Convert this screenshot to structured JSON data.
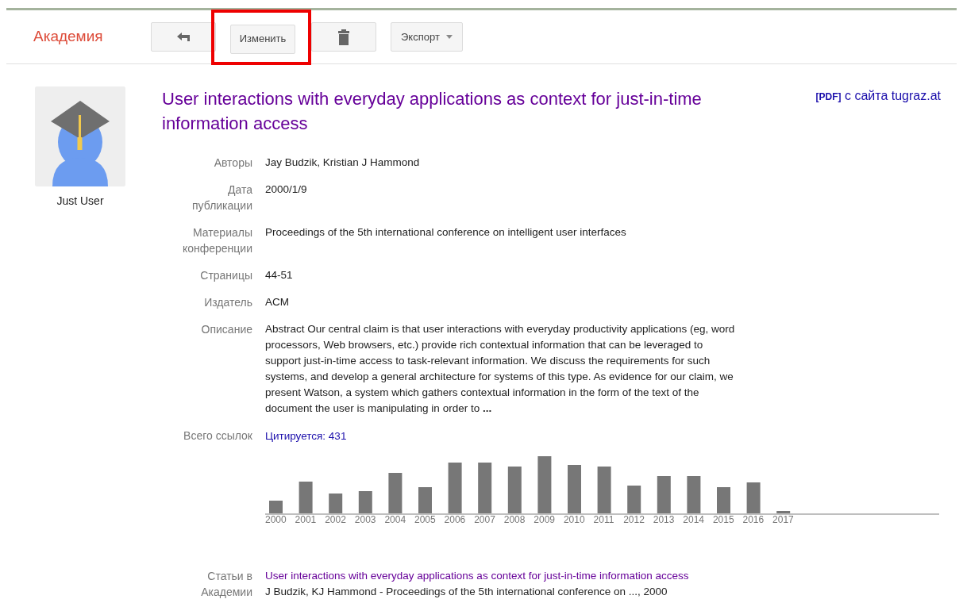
{
  "header": {
    "logo": "Академия",
    "buttons": [
      {
        "kind": "back",
        "highlighted": false
      },
      {
        "kind": "text",
        "label": "Изменить",
        "highlighted": true
      },
      {
        "kind": "delete",
        "highlighted": false
      },
      {
        "kind": "dropdown",
        "label": "Экспорт",
        "highlighted": false
      }
    ]
  },
  "profile": {
    "name": "Just User"
  },
  "article": {
    "title": "User interactions with everyday applications as context for just-in-time information access",
    "source_tag": "[PDF]",
    "source": "с сайта tugraz.at"
  },
  "fields": [
    {
      "kind": "text",
      "label": "Авторы",
      "value": "Jay Budzik, Kristian J Hammond"
    },
    {
      "kind": "text",
      "label": "Дата публикации",
      "value": "2000/1/9"
    },
    {
      "kind": "text",
      "label": "Материалы конференции",
      "value": "Proceedings of the 5th international conference on intelligent user interfaces"
    },
    {
      "kind": "text",
      "label": "Страницы",
      "value": "44-51"
    },
    {
      "kind": "text",
      "label": "Издатель",
      "value": "ACM"
    },
    {
      "kind": "text",
      "label": "Описание",
      "value": "Abstract Our central claim is that user interactions with everyday productivity applications (eg, word processors, Web browsers, etc.) provide rich contextual information that can be leveraged to support just-in-time access to task-relevant information. We discuss the requirements for such systems, and develop a general architecture for systems of this type. As evidence for our claim, we present Watson, a system which gathers contextual information in the form of the text of the document the user is manipulating in order to **...**"
    },
    {
      "kind": "citations",
      "label": "Всего ссылок",
      "value": "Цитируется: 431",
      "years": [
        "2000",
        "2001",
        "2002",
        "2003",
        "2004",
        "2005",
        "2006",
        "2007",
        "2008",
        "2009",
        "2010",
        "2011",
        "2012",
        "2013",
        "2014",
        "2015",
        "2016",
        "2017"
      ]
    },
    {
      "kind": "articles",
      "label": "Статьи в Академии",
      "value": "User interactions with everyday applications as context for just-in-time information access",
      "detail": "J Budzik, KJ Hammond - Proceedings of the 5th international conference on ..., 2000"
    }
  ]
}
